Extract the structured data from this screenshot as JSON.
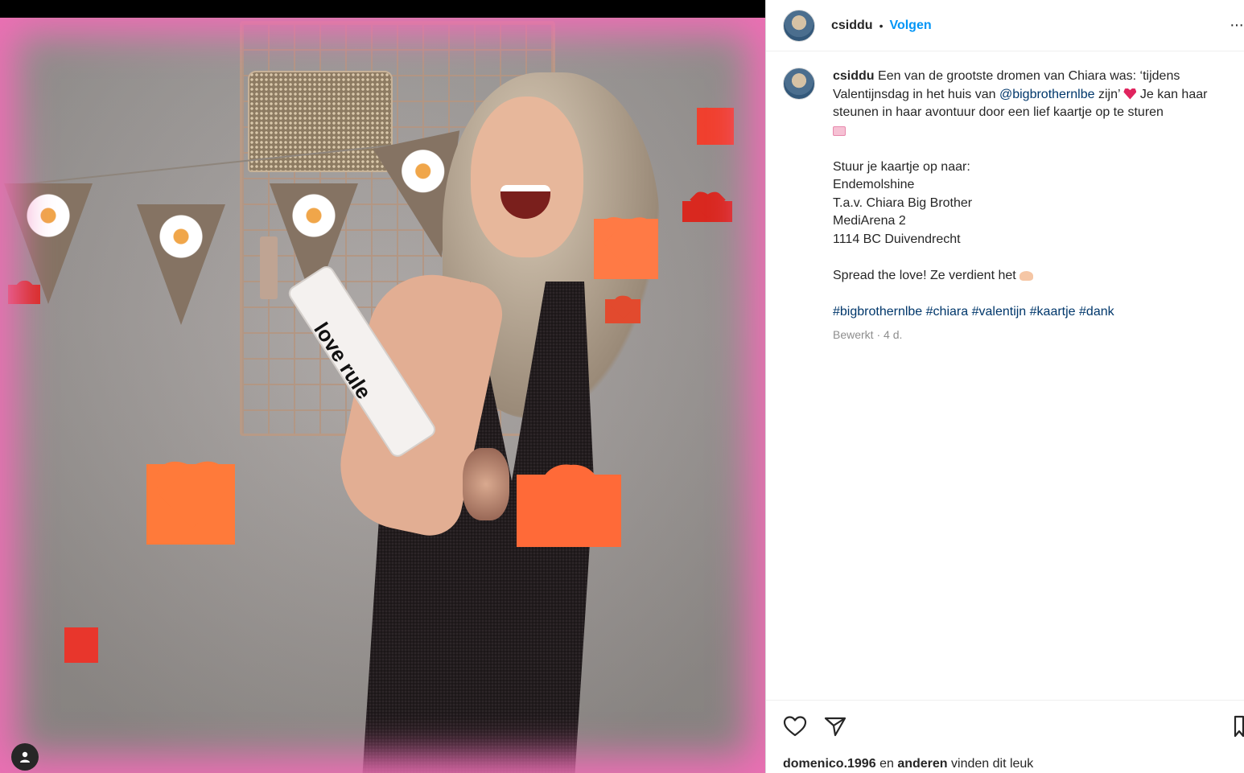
{
  "post": {
    "username": "csiddu",
    "separator": "•",
    "follow_label": "Volgen",
    "more_label": "···",
    "caption": {
      "username": "csiddu",
      "text_1": "Een van de grootste dromen van Chiara was: ‘tijdens Valentijnsdag in het huis van",
      "mention": "@bigbrothernlbe",
      "text_2": "zijn’",
      "text_3": "Je kan haar steunen in haar avontuur door een lief kaartje op te sturen",
      "address_intro": "Stuur je kaartje op naar:",
      "address_line_1": "Endemolshine",
      "address_line_2": "T.a.v. Chiara Big Brother",
      "address_line_3": "MediArena 2",
      "address_line_4": "1114 BC Duivendrecht",
      "closing": "Spread the love! Ze verdient het",
      "hashtags": [
        "#bigbrothernlbe",
        "#chiara",
        "#valentijn",
        "#kaartje",
        "#dank"
      ],
      "meta": "Bewerkt · 4 d."
    },
    "likes": {
      "user": "domenico.1996",
      "middle": "en",
      "others": "anderen",
      "suffix": "vinden dit leuk"
    },
    "photo": {
      "popper_text": "love rule"
    }
  },
  "icons": [
    "user-icon",
    "heart-icon",
    "share-icon",
    "bookmark-icon",
    "more-icon"
  ],
  "colors": {
    "accent": "#0095f6",
    "link": "#00376b",
    "text": "#262626",
    "muted": "#8e8e8e",
    "photo_border": "#ec6fb4"
  }
}
